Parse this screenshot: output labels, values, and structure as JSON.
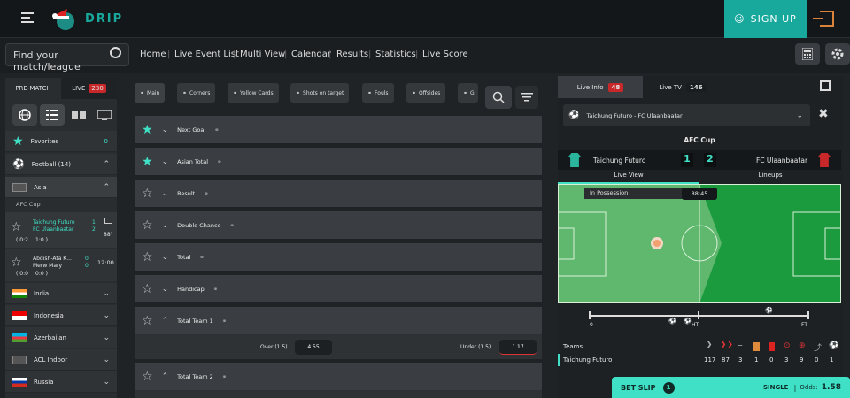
{
  "brand": {
    "name": "DRIP"
  },
  "header": {
    "signup_label": "SIGN UP"
  },
  "search": {
    "placeholder": "Find your match/league"
  },
  "nav": [
    "Home",
    "Live Event List",
    "Multi View",
    "Calendar",
    "Results",
    "Statistics",
    "Live Score"
  ],
  "sidebar": {
    "prematch": "PRE-MATCH",
    "live": "LIVE",
    "live_count": "230",
    "favorites": "Favorites",
    "favorites_count": "0",
    "football": "Football (14)",
    "asia": "Asia",
    "afc_cup": "AFC Cup",
    "match1": {
      "home": "Taichung Futuro",
      "away": "FC Ulaanbaatar",
      "hs": "1",
      "as": "2",
      "minute": "88'",
      "ht": "( 0:2",
      "ft": "1:0 )"
    },
    "match2": {
      "home": "Abdish-Ata K...",
      "away": "Merw Mary",
      "hs": "0",
      "as": "0",
      "time": "12:00",
      "score": "( 0:0",
      "s2": "0:0 )"
    },
    "countries": [
      "India",
      "Indonesia",
      "Azerbaijan",
      "ACL Indoor",
      "Russia"
    ]
  },
  "tabs": [
    "Main",
    "Corners",
    "Yellow Cards",
    "Shots on target",
    "Fouls",
    "Offsides",
    "G"
  ],
  "markets": [
    "Next Goal",
    "Asian Total",
    "Result",
    "Double Chance",
    "Total",
    "Handicap",
    "Total Team 1",
    "Total Team 2"
  ],
  "odds": {
    "over_label": "Over (1.5)",
    "over_value": "4.55",
    "under_label": "Under (1.5)",
    "under_value": "1.17"
  },
  "right": {
    "live_info": "Live Info",
    "live_info_count": "48",
    "live_tv": "Live TV",
    "live_tv_count": "146",
    "match_select": "Taichung Futuro - FC Ulaanbaatar",
    "competition": "AFC Cup",
    "home": "Taichung Futuro",
    "away": "FC Ulaanbaatar",
    "home_score": "1",
    "away_score": "2",
    "live_view": "Live View",
    "lineups": "Lineups",
    "possession": "In Possession",
    "clock": "88:45",
    "timeline_start": "0",
    "timeline_ht": "HT",
    "timeline_ft": "FT",
    "teams_label": "Teams",
    "team_row_name": "Taichung Futuro",
    "team_stats": [
      "117",
      "87",
      "3",
      "1",
      "0",
      "3",
      "9",
      "0",
      "1"
    ]
  },
  "betslip": {
    "label": "BET SLIP",
    "count": "1",
    "single": "SINGLE",
    "odds_label": "Odds:",
    "odds_value": "1.58"
  }
}
